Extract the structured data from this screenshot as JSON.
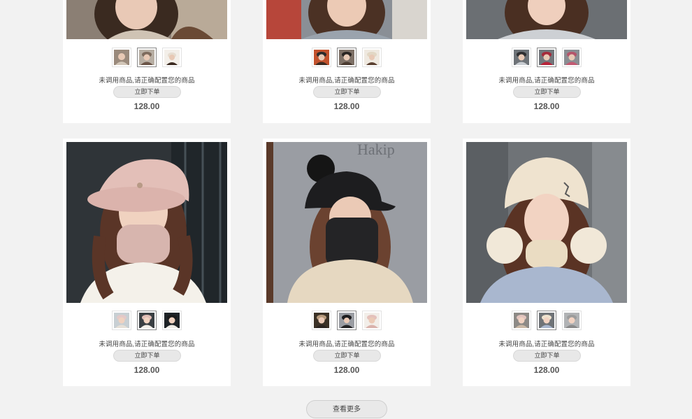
{
  "products": [
    {
      "name": "未调用商品,请正确配置您的商品",
      "buy_label": "立即下单",
      "price": "128.00"
    },
    {
      "name": "未调用商品,请正确配置您的商品",
      "buy_label": "立即下单",
      "price": "128.00"
    },
    {
      "name": "未调用商品,请正确配置您的商品",
      "buy_label": "立即下单",
      "price": "128.00"
    },
    {
      "name": "未调用商品,请正确配置您的商品",
      "buy_label": "立即下单",
      "price": "128.00"
    },
    {
      "name": "未调用商品,请正确配置您的商品",
      "buy_label": "立即下单",
      "price": "128.00"
    },
    {
      "name": "未调用商品,请正确配置您的商品",
      "buy_label": "立即下单",
      "price": "128.00"
    }
  ],
  "load_more_label": "查看更多",
  "colors": {
    "page_bg": "#f2f2f2",
    "card_bg": "#ffffff",
    "button_bg": "#e8e8e8",
    "price_text": "#555555"
  }
}
